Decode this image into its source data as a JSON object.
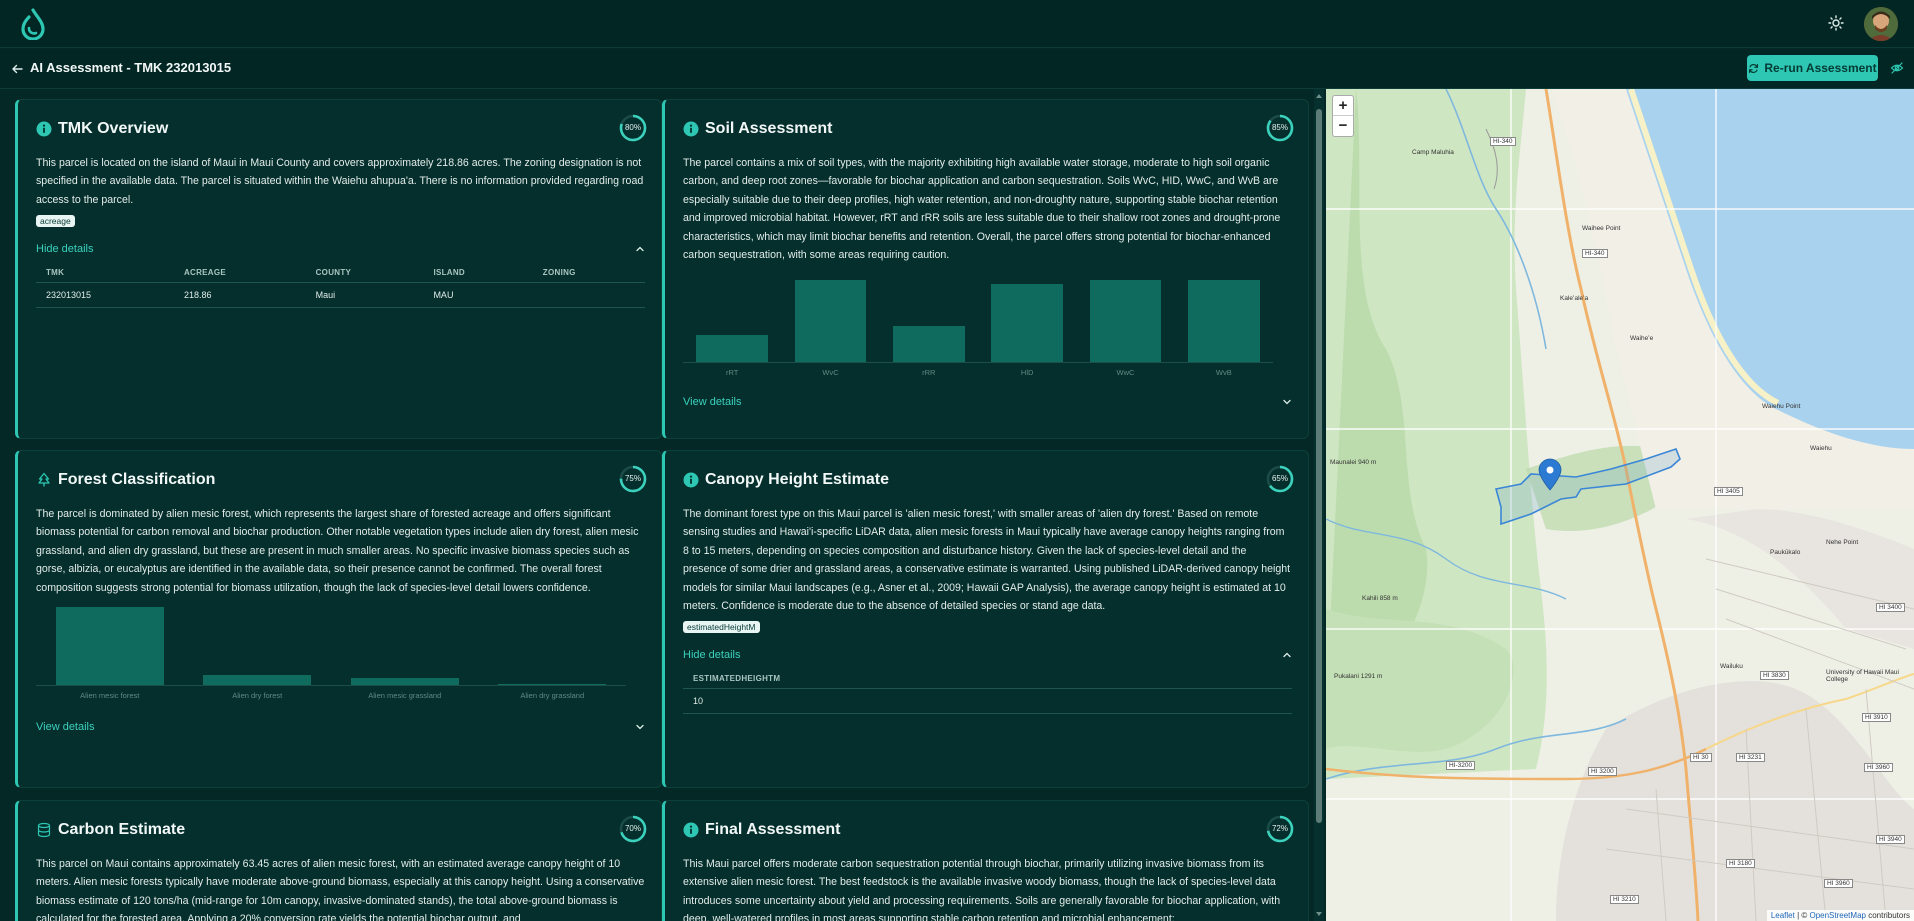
{
  "header": {
    "page_title": "AI Assessment - TMK 232013015",
    "rerun_label": "Re-run Assessment"
  },
  "cards": {
    "tmk": {
      "title": "TMK Overview",
      "confidence": "80%",
      "text": "This parcel is located on the island of Maui in Maui County and covers approximately 218.86 acres. The zoning designation is not specified in the available data. The parcel is situated within the Waiehu ahupua'a. There is no information provided regarding road access to the parcel.",
      "tag": "acreage",
      "toggle": "Hide details",
      "table": {
        "headers": [
          "TMK",
          "ACREAGE",
          "COUNTY",
          "ISLAND",
          "ZONING"
        ],
        "row": [
          "232013015",
          "218.86",
          "Maui",
          "MAU",
          ""
        ]
      }
    },
    "soil": {
      "title": "Soil Assessment",
      "confidence": "85%",
      "text": "The parcel contains a mix of soil types, with the majority exhibiting high available water storage, moderate to high soil organic carbon, and deep root zones—favorable for biochar application and carbon sequestration. Soils WvC, HID, WwC, and WvB are especially suitable due to their deep profiles, high water retention, and non-droughty nature, supporting stable biochar retention and improved microbial habitat. However, rRT and rRR soils are less suitable due to their shallow root zones and drought-prone characteristics, which may limit biochar benefits and retention. Overall, the parcel offers strong potential for biochar-enhanced carbon sequestration, with some areas requiring caution.",
      "toggle": "View details"
    },
    "forest": {
      "title": "Forest Classification",
      "confidence": "75%",
      "text": "The parcel is dominated by alien mesic forest, which represents the largest share of forested acreage and offers significant biomass potential for carbon removal and biochar production. Other notable vegetation types include alien dry forest, alien mesic grassland, and alien dry grassland, but these are present in much smaller areas. No specific invasive biomass species such as gorse, albizia, or eucalyptus are identified in the available data, so their presence cannot be confirmed. The overall forest composition suggests strong potential for biomass utilization, though the lack of species-level detail lowers confidence.",
      "toggle": "View details"
    },
    "canopy": {
      "title": "Canopy Height Estimate",
      "confidence": "65%",
      "text": "The dominant forest type on this Maui parcel is 'alien mesic forest,' with smaller areas of 'alien dry forest.' Based on remote sensing studies and Hawai'i-specific LiDAR data, alien mesic forests in Maui typically have average canopy heights ranging from 8 to 15 meters, depending on species composition and disturbance history. Given the lack of species-level detail and the presence of some drier and grassland areas, a conservative estimate is warranted. Using published LiDAR-derived canopy height models for similar Maui landscapes (e.g., Asner et al., 2009; Hawaii GAP Analysis), the average canopy height is estimated at 10 meters. Confidence is moderate due to the absence of detailed species or stand age data.",
      "tag": "estimatedHeightM",
      "toggle": "Hide details",
      "table": {
        "headers": [
          "ESTIMATEDHEIGHTM"
        ],
        "row": [
          "10"
        ]
      }
    },
    "carbon": {
      "title": "Carbon Estimate",
      "confidence": "70%",
      "text": "This parcel on Maui contains approximately 63.45 acres of alien mesic forest, with an estimated average canopy height of 10 meters. Alien mesic forests typically have moderate above-ground biomass, especially at this canopy height. Using a conservative biomass estimate of 120 tons/ha (mid-range for 10m canopy, invasive-dominated stands), the total above-ground biomass is calculated for the forested area. Applying a 20% conversion rate yields the potential biochar output, and"
    },
    "final": {
      "title": "Final Assessment",
      "confidence": "72%",
      "text": "This Maui parcel offers moderate carbon sequestration potential through biochar, primarily utilizing invasive biomass from its extensive alien mesic forest. The best feedstock is the available invasive woody biomass, though the lack of species-level data introduces some uncertainty about yield and processing requirements. Soils are generally favorable for biochar application, with deep, well-watered profiles in most areas supporting stable carbon retention and microbial enhancement;"
    }
  },
  "chart_data": [
    {
      "type": "bar",
      "categories": [
        "rRT",
        "WvC",
        "rRR",
        "HlD",
        "WwC",
        "WvB"
      ],
      "values": [
        30,
        92,
        40,
        87,
        92,
        92
      ],
      "ylim": [
        0,
        100
      ]
    },
    {
      "type": "bar",
      "categories": [
        "Alien mesic forest",
        "Alien dry forest",
        "Alien mesic grassland",
        "Alien dry grassland"
      ],
      "values": [
        63.45,
        8,
        6,
        0.5
      ],
      "ylim": [
        0,
        65
      ]
    }
  ],
  "map": {
    "zoom_in": "+",
    "zoom_out": "−",
    "attribution_leaflet": "Leaflet",
    "attribution_sep": " | © ",
    "attribution_osm": "OpenStreetMap",
    "attribution_tail": " contributors",
    "labels": {
      "camp": "Camp Maluhia",
      "waihee_point": "Waihee Point",
      "kaleale": "Kaleʻaleʻa",
      "waihee": "Waiheʻe",
      "waiehu_point": "Waiehu Point",
      "waiehu": "Waiehu",
      "mauna": "Maunalei 940 m",
      "nehe": "Nehe Point",
      "paukukalo": "Paukūkalo",
      "wailuku": "Wailuku",
      "university": "University of Hawaii Maui College",
      "kahili": "Kahili 858 m",
      "pukalani": "Pukalani 1291 m"
    },
    "shields": [
      "HI-340",
      "HI-340",
      "HI 3405",
      "HI 3400",
      "HI 3830",
      "HI 3910",
      "HI-3200",
      "HI 3200",
      "HI 30",
      "HI 3231",
      "HI 3960",
      "HI 3940",
      "HI 3180",
      "HI 3210",
      "HI 3960"
    ]
  }
}
